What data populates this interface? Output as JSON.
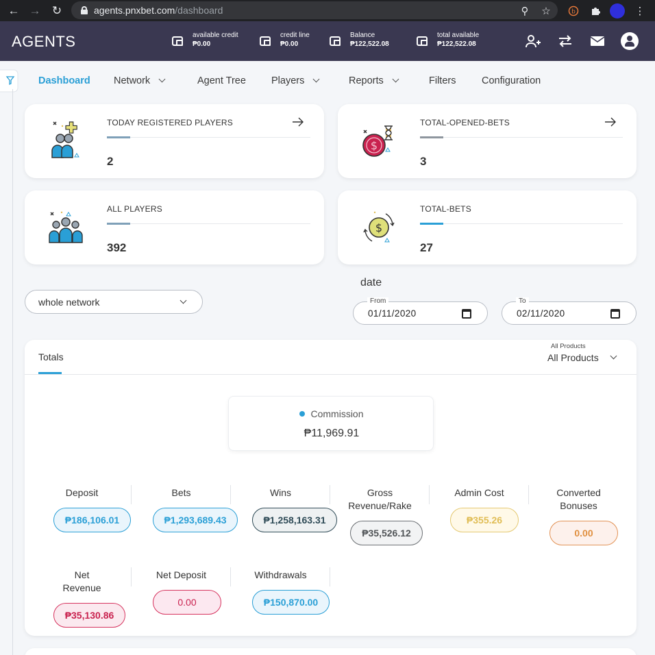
{
  "browser": {
    "url_host": "agents.pnxbet.com",
    "url_path": "/dashboard"
  },
  "header": {
    "brand": "AGENTS",
    "balances": [
      {
        "label": "available credit",
        "value": "₱0.00"
      },
      {
        "label": "credit line",
        "value": "₱0.00"
      },
      {
        "label": "Balance",
        "value": "₱122,522.08"
      },
      {
        "label": "total available",
        "value": "₱122,522.08"
      }
    ]
  },
  "menu": {
    "items": [
      {
        "label": "Dashboard",
        "active": true,
        "dropdown": false
      },
      {
        "label": "Network",
        "active": false,
        "dropdown": true
      },
      {
        "label": "Agent Tree",
        "active": false,
        "dropdown": false
      },
      {
        "label": "Players",
        "active": false,
        "dropdown": true
      },
      {
        "label": "Reports",
        "active": false,
        "dropdown": true
      },
      {
        "label": "Filters",
        "active": false,
        "dropdown": false
      },
      {
        "label": "Configuration",
        "active": false,
        "dropdown": false
      }
    ]
  },
  "stats": [
    {
      "title": "TODAY REGISTERED PLAYERS",
      "value": "2",
      "icon": "users-add-icon",
      "has_arrow": true
    },
    {
      "title": "TOTAL-OPENED-BETS",
      "value": "3",
      "icon": "coin-hourglass-icon",
      "has_arrow": true
    },
    {
      "title": "ALL PLAYERS",
      "value": "392",
      "icon": "users-group-icon",
      "has_arrow": false
    },
    {
      "title": "TOTAL-BETS",
      "value": "27",
      "icon": "coin-cycle-icon",
      "has_arrow": false
    }
  ],
  "filters": {
    "network_select": "whole network",
    "date_label": "date",
    "from_caption": "From",
    "from_value": "01/11/2020",
    "to_caption": "To",
    "to_value": "02/11/2020"
  },
  "totals": {
    "tab_label": "Totals",
    "products_caption": "All Products",
    "products_value": "All Products",
    "commission_label": "Commission",
    "commission_value": "₱11,969.91",
    "accent_color": "#2a9fd6",
    "metrics": [
      {
        "label": "Deposit",
        "value": "₱186,106.01",
        "style": "blue"
      },
      {
        "label": "Bets",
        "value": "₱1,293,689.43",
        "style": "blue"
      },
      {
        "label": "Wins",
        "value": "₱1,258,163.31",
        "style": "dark"
      },
      {
        "label": "Gross Revenue/Rake",
        "value": "₱35,526.12",
        "style": "grey"
      },
      {
        "label": "Admin Cost",
        "value": "₱355.26",
        "style": "yellow"
      },
      {
        "label": "Converted Bonuses",
        "value": "0.00",
        "style": "orange"
      },
      {
        "label": "Net Revenue",
        "value": "₱35,130.86",
        "style": "red"
      },
      {
        "label": "Net Deposit",
        "value": "0.00",
        "style": "pink"
      },
      {
        "label": "Withdrawals",
        "value": "₱150,870.00",
        "style": "blue"
      }
    ]
  }
}
